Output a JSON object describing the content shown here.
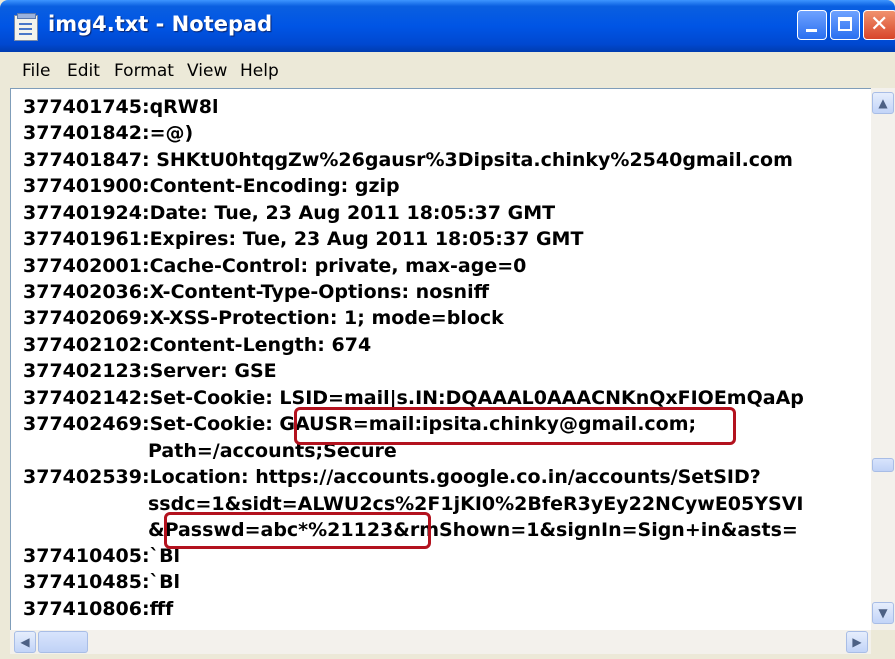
{
  "window": {
    "title": "img4.txt - Notepad"
  },
  "menu": {
    "file": "File",
    "edit": "Edit",
    "format": "Format",
    "view": "View",
    "help": "Help"
  },
  "lines": [
    "377401745:qRW8l",
    "377401842:=@)",
    "377401847: SHKtU0htqgZw%26gausr%3Dipsita.chinky%2540gmail.com",
    "377401900:Content-Encoding: gzip",
    "377401924:Date: Tue, 23 Aug 2011 18:05:37 GMT",
    "377401961:Expires: Tue, 23 Aug 2011 18:05:37 GMT",
    "377402001:Cache-Control: private, max-age=0",
    "377402036:X-Content-Type-Options: nosniff",
    "377402069:X-XSS-Protection: 1; mode=block",
    "377402102:Content-Length: 674",
    "377402123:Server: GSE",
    "377402142:Set-Cookie: LSID=mail|s.IN:DQAAAL0AAACNKnQxFIOEmQaAp",
    "377402469:Set-Cookie: GAUSR=mail:ipsita.chinky@gmail.com;",
    "Path=/accounts;Secure",
    "377402539:Location: https://accounts.google.co.in/accounts/SetSID?",
    "ssdc=1&sidt=ALWU2cs%2F1jKI0%2BfeR3yEy22NCywE05YSVI",
    "&Passwd=abc*%21123&rmShown=1&signIn=Sign+in&asts=",
    "377410405:`Bl",
    "377410485:`Bl",
    "377410806:fff"
  ],
  "colors": {
    "highlight": "#b3121e",
    "titlebar": "#0055e5"
  },
  "icons": {
    "app": "notepad-icon",
    "minimize": "minimize-icon",
    "maximize": "maximize-icon",
    "close": "close-icon"
  }
}
